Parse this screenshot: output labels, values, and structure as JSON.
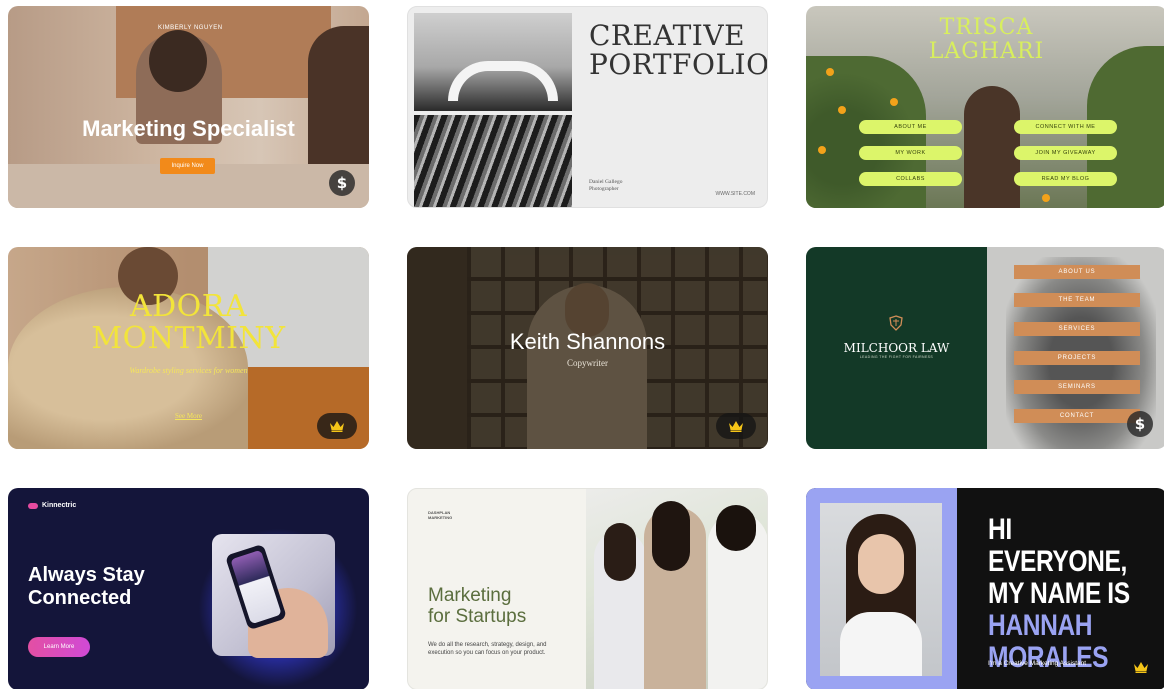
{
  "cards": [
    {
      "id": "marketing-specialist",
      "name": "KIMBERLY NGUYEN",
      "title": "Marketing Specialist",
      "button": "Inquire Now",
      "badge": "$"
    },
    {
      "id": "creative-portfolio",
      "title_line1": "CREATIVE",
      "title_line2": "PORTFOLIO",
      "author": "Daniel Gallego",
      "role": "Photographer",
      "footer_right": "WWW.SITE.COM"
    },
    {
      "id": "trisca-laghari",
      "title_line1": "TRISCA",
      "title_line2": "LAGHARI",
      "links": [
        "ABOUT ME",
        "MY WORK",
        "COLLABS",
        "CONNECT WITH ME",
        "JOIN MY GIVEAWAY",
        "READ MY BLOG"
      ]
    },
    {
      "id": "adora-montminy",
      "title_line1": "ADORA",
      "title_line2": "MONTMINY",
      "subtitle": "Wardrobe styling services for women",
      "link": "See More",
      "badge": "crown"
    },
    {
      "id": "keith-shannons",
      "title": "Keith Shannons",
      "subtitle": "Copywriter",
      "badge": "crown"
    },
    {
      "id": "milchoor-law",
      "name": "MILCHOOR LAW",
      "tagline": "LEADING THE FIGHT FOR FAIRNESS",
      "menu": [
        "ABOUT US",
        "THE TEAM",
        "SERVICES",
        "PROJECTS",
        "SEMINARS",
        "CONTACT"
      ],
      "badge": "$"
    },
    {
      "id": "kinnectric",
      "brand": "Kinnectric",
      "title_line1": "Always Stay",
      "title_line2": "Connected",
      "button": "Learn More"
    },
    {
      "id": "marketing-startups",
      "brand_line1": "DASHPLAN",
      "brand_line2": "MARKETING",
      "title_line1": "Marketing",
      "title_line2": "for Startups",
      "body": "We do all the research, strategy, design, and execution so you can focus on your product."
    },
    {
      "id": "hannah-morales",
      "line1": "HI EVERYONE,",
      "line2": "MY NAME IS",
      "line3": "HANNAH",
      "line4": "MORALES",
      "subtitle": "I'm a Creative Marketing Assistant",
      "badge": "crown"
    }
  ],
  "colors": {
    "trisca_accent": "#dcf56a",
    "milchoor_green": "#133927",
    "milchoor_menu": "#d08d57",
    "hannah_accent": "#9aa3f2",
    "kinnectric_pink": "#e34fa3",
    "startups_green": "#5b6e3e",
    "adora_yellow": "#f2e43a"
  }
}
